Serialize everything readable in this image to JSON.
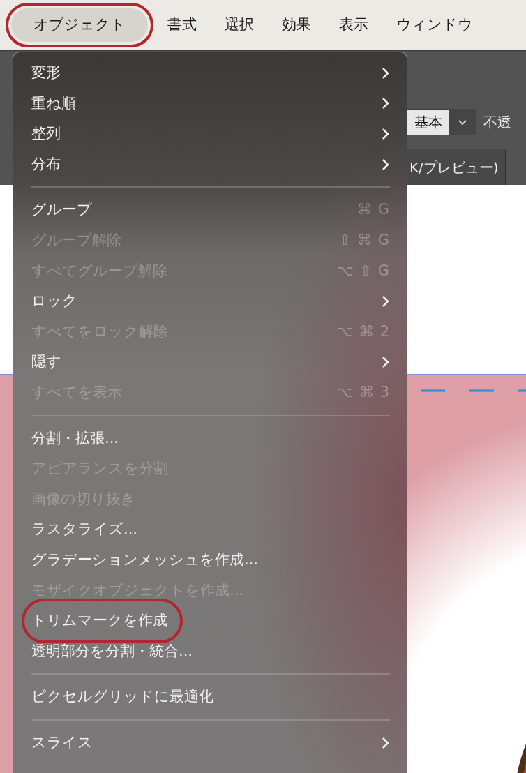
{
  "menubar": [
    {
      "label": "オブジェクト",
      "selected": true,
      "highlighted": true
    },
    {
      "label": "書式",
      "selected": false,
      "highlighted": false
    },
    {
      "label": "選択",
      "selected": false,
      "highlighted": false
    },
    {
      "label": "効果",
      "selected": false,
      "highlighted": false
    },
    {
      "label": "表示",
      "selected": false,
      "highlighted": false
    },
    {
      "label": "ウィンドウ",
      "selected": false,
      "highlighted": false
    }
  ],
  "toolbar": {
    "style_value": "基本",
    "opacity_label": "不透"
  },
  "document_tab": {
    "label": "K/プレビュー)"
  },
  "menu": [
    {
      "kind": "item",
      "label": "変形",
      "enabled": true,
      "submenu": true,
      "highlighted": false
    },
    {
      "kind": "item",
      "label": "重ね順",
      "enabled": true,
      "submenu": true,
      "highlighted": false
    },
    {
      "kind": "item",
      "label": "整列",
      "enabled": true,
      "submenu": true,
      "highlighted": false
    },
    {
      "kind": "item",
      "label": "分布",
      "enabled": true,
      "submenu": true,
      "highlighted": false
    },
    {
      "kind": "separator"
    },
    {
      "kind": "item",
      "label": "グループ",
      "enabled": true,
      "submenu": false,
      "shortcut": "⌘ G",
      "highlighted": false
    },
    {
      "kind": "item",
      "label": "グループ解除",
      "enabled": false,
      "submenu": false,
      "shortcut": "⇧ ⌘ G",
      "highlighted": false
    },
    {
      "kind": "item",
      "label": "すべてグループ解除",
      "enabled": false,
      "submenu": false,
      "shortcut": "⌥ ⇧ G",
      "highlighted": false
    },
    {
      "kind": "item",
      "label": "ロック",
      "enabled": true,
      "submenu": true,
      "highlighted": false
    },
    {
      "kind": "item",
      "label": "すべてをロック解除",
      "enabled": false,
      "submenu": false,
      "shortcut": "⌥ ⌘ 2",
      "highlighted": false
    },
    {
      "kind": "item",
      "label": "隠す",
      "enabled": true,
      "submenu": true,
      "highlighted": false
    },
    {
      "kind": "item",
      "label": "すべてを表示",
      "enabled": false,
      "submenu": false,
      "shortcut": "⌥ ⌘ 3",
      "highlighted": false
    },
    {
      "kind": "separator"
    },
    {
      "kind": "item",
      "label": "分割・拡張...",
      "enabled": true,
      "submenu": false,
      "highlighted": false
    },
    {
      "kind": "item",
      "label": "アピアランスを分割",
      "enabled": false,
      "submenu": false,
      "highlighted": false
    },
    {
      "kind": "item",
      "label": "画像の切り抜き",
      "enabled": false,
      "submenu": false,
      "highlighted": false
    },
    {
      "kind": "item",
      "label": "ラスタライズ...",
      "enabled": true,
      "submenu": false,
      "highlighted": false
    },
    {
      "kind": "item",
      "label": "グラデーションメッシュを作成...",
      "enabled": true,
      "submenu": false,
      "highlighted": false
    },
    {
      "kind": "item",
      "label": "モザイクオブジェクトを作成...",
      "enabled": false,
      "submenu": false,
      "highlighted": false
    },
    {
      "kind": "item",
      "label": "トリムマークを作成",
      "enabled": true,
      "submenu": false,
      "highlighted": true
    },
    {
      "kind": "item",
      "label": "透明部分を分割・統合...",
      "enabled": true,
      "submenu": false,
      "highlighted": false
    },
    {
      "kind": "separator"
    },
    {
      "kind": "item",
      "label": "ピクセルグリッドに最適化",
      "enabled": true,
      "submenu": false,
      "highlighted": false
    },
    {
      "kind": "separator"
    },
    {
      "kind": "item",
      "label": "スライス",
      "enabled": true,
      "submenu": true,
      "highlighted": false
    }
  ]
}
